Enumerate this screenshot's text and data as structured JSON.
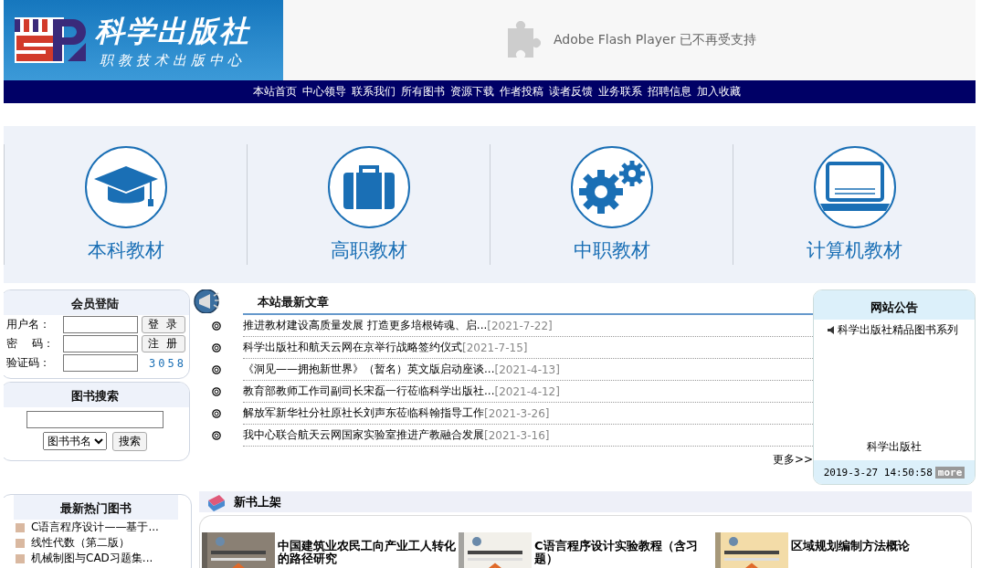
{
  "header": {
    "logo": {
      "title": "科学出版社",
      "subtitle": "职教技术出版中心"
    },
    "plugin_notice": "Adobe Flash Player 已不再受支持"
  },
  "nav": [
    "本站首页",
    "中心领导",
    "联系我们",
    "所有图书",
    "资源下载",
    "作者投稿",
    "读者反馈",
    "业务联系",
    "招聘信息",
    "加入收藏"
  ],
  "categories": [
    {
      "label": "本科教材",
      "kind": "cap"
    },
    {
      "label": "高职教材",
      "kind": "briefcase"
    },
    {
      "label": "中职教材",
      "kind": "gears"
    },
    {
      "label": "计算机教材",
      "kind": "laptop"
    }
  ],
  "login": {
    "title": "会员登陆",
    "rows": [
      {
        "label": "用户名：",
        "button": "登 录"
      },
      {
        "label": "密　 码：",
        "button": "注 册"
      },
      {
        "label": "验证码：",
        "captcha": "3058"
      }
    ]
  },
  "search": {
    "title": "图书搜索",
    "select": "图书书名",
    "button": "搜索"
  },
  "hot_books": {
    "title": "最新热门图书",
    "items": [
      "C语言程序设计——基于...",
      "线性代数（第二版）",
      "机械制图与CAD习题集..."
    ]
  },
  "articles": {
    "title": "本站最新文章",
    "items": [
      {
        "title": "推进教材建设高质量发展 打造更多培根铸魂、启...",
        "date": "[2021-7-22]"
      },
      {
        "title": "科学出版社和航天云网在京举行战略签约仪式",
        "date": "[2021-7-15]"
      },
      {
        "title": "《洞见——拥抱新世界》（暂名）英文版启动座谈...",
        "date": "[2021-4-13]"
      },
      {
        "title": "教育部教师工作司副司长宋磊一行莅临科学出版社...",
        "date": "[2021-4-12]"
      },
      {
        "title": "解放军新华社分社原社长刘声东莅临科翰指导工作",
        "date": "[2021-3-26]"
      },
      {
        "title": "我中心联合航天云网国家实验室推进产教融合发展",
        "date": "[2021-3-16]"
      }
    ],
    "more": "更多>>"
  },
  "notice": {
    "title": "网站公告",
    "items": [
      "科学出版社精品图书系列"
    ],
    "signature": "科学出版社",
    "timestamp": "2019-3-27 14:50:58",
    "more": "more"
  },
  "new_books": {
    "title": "新书上架",
    "items": [
      {
        "title": "中国建筑业农民工向产业工人转化的路径研究",
        "kind": "picture"
      },
      {
        "title": "C语言程序设计实验教程（含习题）",
        "kind": "picture"
      },
      {
        "title": "区域规划编制方法概论",
        "kind": "picture"
      }
    ]
  }
}
